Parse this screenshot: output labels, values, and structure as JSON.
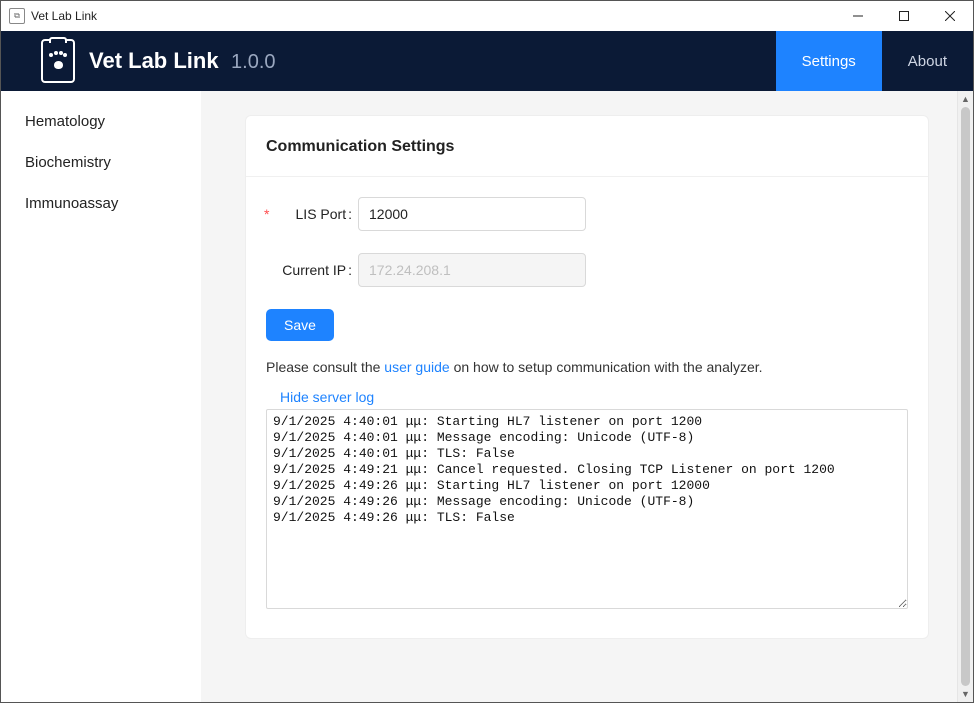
{
  "window": {
    "title": "Vet Lab Link"
  },
  "header": {
    "app_name": "Vet Lab Link",
    "version": "1.0.0",
    "nav": {
      "settings": "Settings",
      "about": "About"
    }
  },
  "sidebar": {
    "items": [
      {
        "label": "Hematology"
      },
      {
        "label": "Biochemistry"
      },
      {
        "label": "Immunoassay"
      }
    ]
  },
  "settings": {
    "card_title": "Communication Settings",
    "lis_port_label": "LIS Port",
    "lis_port_value": "12000",
    "current_ip_label": "Current IP",
    "current_ip_value": "172.24.208.1",
    "save_label": "Save",
    "hint_prefix": "Please consult the ",
    "hint_link": "user guide",
    "hint_suffix": " on how to setup communication with the analyzer.",
    "log_toggle": "Hide server log",
    "log_text": "9/1/2025 4:40:01 μμ: Starting HL7 listener on port 1200\n9/1/2025 4:40:01 μμ: Message encoding: Unicode (UTF-8)\n9/1/2025 4:40:01 μμ: TLS: False\n9/1/2025 4:49:21 μμ: Cancel requested. Closing TCP Listener on port 1200\n9/1/2025 4:49:26 μμ: Starting HL7 listener on port 12000\n9/1/2025 4:49:26 μμ: Message encoding: Unicode (UTF-8)\n9/1/2025 4:49:26 μμ: TLS: False"
  }
}
